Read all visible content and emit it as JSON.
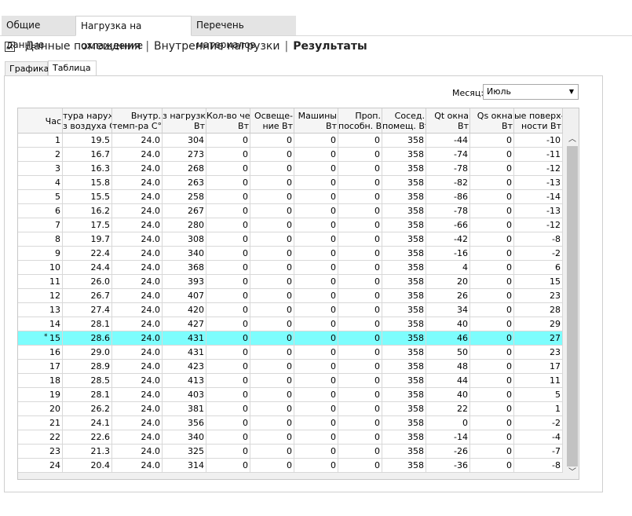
{
  "top_tabs": [
    "Общие данные",
    "Нагрузка на охлаждение",
    "Перечень материалов"
  ],
  "sub_nav": {
    "items": [
      "Данные помещения",
      "Внутренние нагрузки",
      "Результаты"
    ],
    "separator": "|"
  },
  "inner_tabs": [
    "Графика",
    "Таблица"
  ],
  "month": {
    "label": "Месяц:",
    "value": "Июль"
  },
  "table": {
    "headers": [
      [
        "Час"
      ],
      [
        "тура наруж-",
        "з воздуха C°"
      ],
      [
        "Внутр.",
        "темп-ра C°"
      ],
      [
        "з нагрузка",
        "Вт"
      ],
      [
        "Кол-во чел.",
        "Вт"
      ],
      [
        "Освеще-",
        "ние Вт"
      ],
      [
        "Машины",
        "Вт"
      ],
      [
        "Проп.",
        "пособн. Вт"
      ],
      [
        "Сосед.",
        "помещ. Вт"
      ],
      [
        "Qt окна",
        "Вт"
      ],
      [
        "Qs окна",
        "Вт"
      ],
      [
        "ые поверх-",
        "ности Вт"
      ]
    ],
    "selected_marker": "*",
    "rows": [
      [
        "1",
        "19.5",
        "24.0",
        "304",
        "0",
        "0",
        "0",
        "0",
        "358",
        "-44",
        "0",
        "-10"
      ],
      [
        "2",
        "16.7",
        "24.0",
        "273",
        "0",
        "0",
        "0",
        "0",
        "358",
        "-74",
        "0",
        "-11"
      ],
      [
        "3",
        "16.3",
        "24.0",
        "268",
        "0",
        "0",
        "0",
        "0",
        "358",
        "-78",
        "0",
        "-12"
      ],
      [
        "4",
        "15.8",
        "24.0",
        "263",
        "0",
        "0",
        "0",
        "0",
        "358",
        "-82",
        "0",
        "-13"
      ],
      [
        "5",
        "15.5",
        "24.0",
        "258",
        "0",
        "0",
        "0",
        "0",
        "358",
        "-86",
        "0",
        "-14"
      ],
      [
        "6",
        "16.2",
        "24.0",
        "267",
        "0",
        "0",
        "0",
        "0",
        "358",
        "-78",
        "0",
        "-13"
      ],
      [
        "7",
        "17.5",
        "24.0",
        "280",
        "0",
        "0",
        "0",
        "0",
        "358",
        "-66",
        "0",
        "-12"
      ],
      [
        "8",
        "19.7",
        "24.0",
        "308",
        "0",
        "0",
        "0",
        "0",
        "358",
        "-42",
        "0",
        "-8"
      ],
      [
        "9",
        "22.4",
        "24.0",
        "340",
        "0",
        "0",
        "0",
        "0",
        "358",
        "-16",
        "0",
        "-2"
      ],
      [
        "10",
        "24.4",
        "24.0",
        "368",
        "0",
        "0",
        "0",
        "0",
        "358",
        "4",
        "0",
        "6"
      ],
      [
        "11",
        "26.0",
        "24.0",
        "393",
        "0",
        "0",
        "0",
        "0",
        "358",
        "20",
        "0",
        "15"
      ],
      [
        "12",
        "26.7",
        "24.0",
        "407",
        "0",
        "0",
        "0",
        "0",
        "358",
        "26",
        "0",
        "23"
      ],
      [
        "13",
        "27.4",
        "24.0",
        "420",
        "0",
        "0",
        "0",
        "0",
        "358",
        "34",
        "0",
        "28"
      ],
      [
        "14",
        "28.1",
        "24.0",
        "427",
        "0",
        "0",
        "0",
        "0",
        "358",
        "40",
        "0",
        "29"
      ],
      [
        "15",
        "28.6",
        "24.0",
        "431",
        "0",
        "0",
        "0",
        "0",
        "358",
        "46",
        "0",
        "27"
      ],
      [
        "16",
        "29.0",
        "24.0",
        "431",
        "0",
        "0",
        "0",
        "0",
        "358",
        "50",
        "0",
        "23"
      ],
      [
        "17",
        "28.9",
        "24.0",
        "423",
        "0",
        "0",
        "0",
        "0",
        "358",
        "48",
        "0",
        "17"
      ],
      [
        "18",
        "28.5",
        "24.0",
        "413",
        "0",
        "0",
        "0",
        "0",
        "358",
        "44",
        "0",
        "11"
      ],
      [
        "19",
        "28.1",
        "24.0",
        "403",
        "0",
        "0",
        "0",
        "0",
        "358",
        "40",
        "0",
        "5"
      ],
      [
        "20",
        "26.2",
        "24.0",
        "381",
        "0",
        "0",
        "0",
        "0",
        "358",
        "22",
        "0",
        "1"
      ],
      [
        "21",
        "24.1",
        "24.0",
        "356",
        "0",
        "0",
        "0",
        "0",
        "358",
        "0",
        "0",
        "-2"
      ],
      [
        "22",
        "22.6",
        "24.0",
        "340",
        "0",
        "0",
        "0",
        "0",
        "358",
        "-14",
        "0",
        "-4"
      ],
      [
        "23",
        "21.3",
        "24.0",
        "325",
        "0",
        "0",
        "0",
        "0",
        "358",
        "-26",
        "0",
        "-7"
      ],
      [
        "24",
        "20.4",
        "24.0",
        "314",
        "0",
        "0",
        "0",
        "0",
        "358",
        "-36",
        "0",
        "-8"
      ]
    ],
    "selected_row_index": 14,
    "selected_color": "#7dfdfd"
  }
}
